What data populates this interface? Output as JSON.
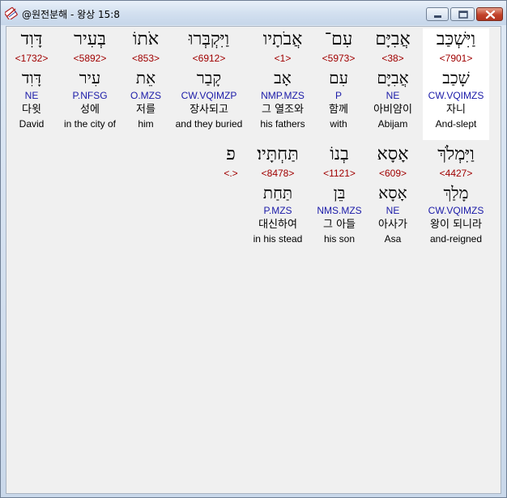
{
  "window": {
    "title": "@원전분해 - 왕상 15:8",
    "icon": "bible-app-icon"
  },
  "rows": [
    {
      "words": [
        {
          "hebrew": "וַיִּשְׁכַּב",
          "strong": "<7901>",
          "lemma": "שָׁכַב",
          "morph": "CW.VQIMZS",
          "korean": "자니",
          "english": "And-slept",
          "selected": true
        },
        {
          "hebrew": "אֲבִיָּם",
          "strong": "<38>",
          "lemma": "אֲבִיָּם",
          "morph": "NE",
          "korean": "아비얌이",
          "english": "Abijam",
          "selected": false
        },
        {
          "hebrew": "עִם־",
          "strong": "<5973>",
          "lemma": "עִם",
          "morph": "P",
          "korean": "함께",
          "english": "with",
          "selected": false
        },
        {
          "hebrew": "אֲבֹתָיו",
          "strong": "<1>",
          "lemma": "אָב",
          "morph": "NMP.MZS",
          "korean": "그 열조와",
          "english": "his fathers",
          "selected": false
        },
        {
          "hebrew": "וַיִּקְבְּרוּ",
          "strong": "<6912>",
          "lemma": "קָבַר",
          "morph": "CW.VQIMZP",
          "korean": "장사되고",
          "english": "and they buried",
          "selected": false
        },
        {
          "hebrew": "אֹתוֹ",
          "strong": "<853>",
          "lemma": "אֵת",
          "morph": "O.MZS",
          "korean": "저를",
          "english": "him",
          "selected": false
        },
        {
          "hebrew": "בְּעִיר",
          "strong": "<5892>",
          "lemma": "עִיר",
          "morph": "P.NFSG",
          "korean": "성에",
          "english": "in the city of",
          "selected": false
        },
        {
          "hebrew": "דָּוִד",
          "strong": "<1732>",
          "lemma": "דָּוִד",
          "morph": "NE",
          "korean": "다윗",
          "english": "David",
          "selected": false
        }
      ]
    },
    {
      "words": [
        {
          "hebrew": "וַיִּמְלֹךְ",
          "strong": "<4427>",
          "lemma": "מָלַךְ",
          "morph": "CW.VQIMZS",
          "korean": "왕이 되니라",
          "english": "and-reigned",
          "selected": false
        },
        {
          "hebrew": "אָסָא",
          "strong": "<609>",
          "lemma": "אָסָא",
          "morph": "NE",
          "korean": "아사가",
          "english": "Asa",
          "selected": false
        },
        {
          "hebrew": "בְנוֹ",
          "strong": "<1121>",
          "lemma": "בֵּן",
          "morph": "NMS.MZS",
          "korean": "그 아들",
          "english": "his son",
          "selected": false
        },
        {
          "hebrew": "תַּחְתָּיו׃",
          "strong": "<8478>",
          "lemma": "תַּחַת",
          "morph": "P.MZS",
          "korean": "대신하여",
          "english": "in his stead",
          "selected": false
        },
        {
          "hebrew": "פ",
          "strong": "<.>",
          "lemma": "",
          "morph": "",
          "korean": "",
          "english": "",
          "selected": false
        }
      ]
    }
  ]
}
